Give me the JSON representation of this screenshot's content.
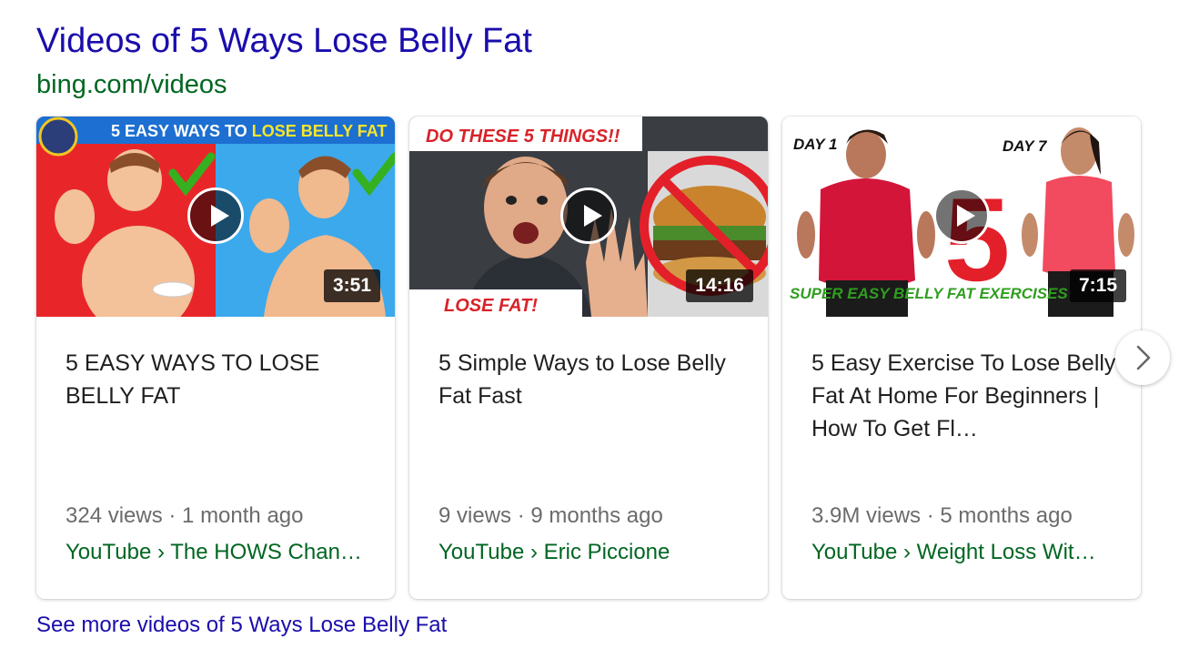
{
  "header": {
    "title": "Videos of 5 Ways Lose Belly Fat",
    "source": "bing.com/videos"
  },
  "videos": [
    {
      "thumb_caption": "5 EASY WAYS TO LOSE BELLY FAT",
      "thumb_caption_part1": "5 EASY WAYS TO ",
      "thumb_caption_part2": "LOSE BELLY FAT",
      "duration": "3:51",
      "title": "5 EASY WAYS TO LOSE BELLY FAT",
      "meta": "324 views · 1 month ago",
      "channel": "YouTube › The HOWS Chan…"
    },
    {
      "thumb_caption_top": "DO THESE 5 THINGS!!",
      "thumb_caption_bottom": "LOSE FAT!",
      "duration": "14:16",
      "title": "5 Simple Ways to Lose Belly Fat Fast",
      "meta": "9 views · 9 months ago",
      "channel": "YouTube › Eric Piccione"
    },
    {
      "thumb_day_left": "DAY 1",
      "thumb_day_right": "DAY 7",
      "thumb_number": "5",
      "thumb_caption": "SUPER EASY BELLY FAT EXERCISES",
      "duration": "7:15",
      "title": "5 Easy Exercise To Lose Belly Fat At Home For Beginners | How To Get Fl…",
      "meta": "3.9M views · 5 months ago",
      "channel": "YouTube › Weight Loss Wit…"
    }
  ],
  "footer": {
    "see_more": "See more videos of 5 Ways Lose Belly Fat"
  },
  "icons": {
    "play": "play-icon",
    "next": "chevron-right-icon"
  },
  "colors": {
    "link": "#1a0dab",
    "source": "#006621",
    "meta": "#6b6b6b"
  }
}
